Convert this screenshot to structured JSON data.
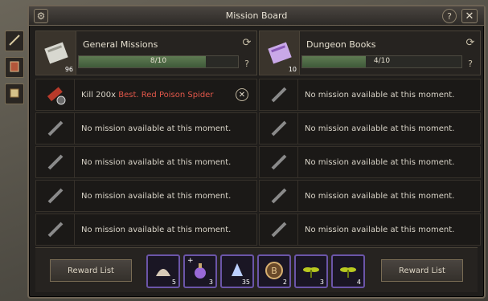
{
  "window": {
    "title": "Mission Board",
    "help": "?",
    "close": "✕"
  },
  "panels": [
    {
      "title": "General Missions",
      "icon_count": "96",
      "progress_label": "8/10",
      "progress": 0.8,
      "help": "?",
      "missions": [
        {
          "prefix": "Kill 200x ",
          "highlight": "Best. Red Poison Spider",
          "active": true
        },
        {
          "prefix": "No mission available at this moment.",
          "highlight": "",
          "active": false
        },
        {
          "prefix": "No mission available at this moment.",
          "highlight": "",
          "active": false
        },
        {
          "prefix": "No mission available at this moment.",
          "highlight": "",
          "active": false
        },
        {
          "prefix": "No mission available at this moment.",
          "highlight": "",
          "active": false
        }
      ]
    },
    {
      "title": "Dungeon Books",
      "icon_count": "10",
      "progress_label": "4/10",
      "progress": 0.4,
      "help": "?",
      "missions": [
        {
          "prefix": "No mission available at this moment.",
          "highlight": "",
          "active": false
        },
        {
          "prefix": "No mission available at this moment.",
          "highlight": "",
          "active": false
        },
        {
          "prefix": "No mission available at this moment.",
          "highlight": "",
          "active": false
        },
        {
          "prefix": "No mission available at this moment.",
          "highlight": "",
          "active": false
        },
        {
          "prefix": "No mission available at this moment.",
          "highlight": "",
          "active": false
        }
      ]
    }
  ],
  "bottom": {
    "reward_list_left": "Reward List",
    "reward_list_right": "Reward List",
    "rewards": [
      {
        "icon": "shell-icon",
        "qty": "5",
        "plus": ""
      },
      {
        "icon": "potion-icon",
        "qty": "3",
        "plus": "+"
      },
      {
        "icon": "crystal-icon",
        "qty": "35",
        "plus": ""
      },
      {
        "icon": "coin-b-icon",
        "qty": "2",
        "plus": ""
      },
      {
        "icon": "herb-icon",
        "qty": "3",
        "plus": ""
      },
      {
        "icon": "herb-icon",
        "qty": "4",
        "plus": ""
      }
    ]
  },
  "colors": {
    "highlight": "#e2574a",
    "reward_border": "#6b55a8",
    "progress_fill": "#5e7a52"
  }
}
